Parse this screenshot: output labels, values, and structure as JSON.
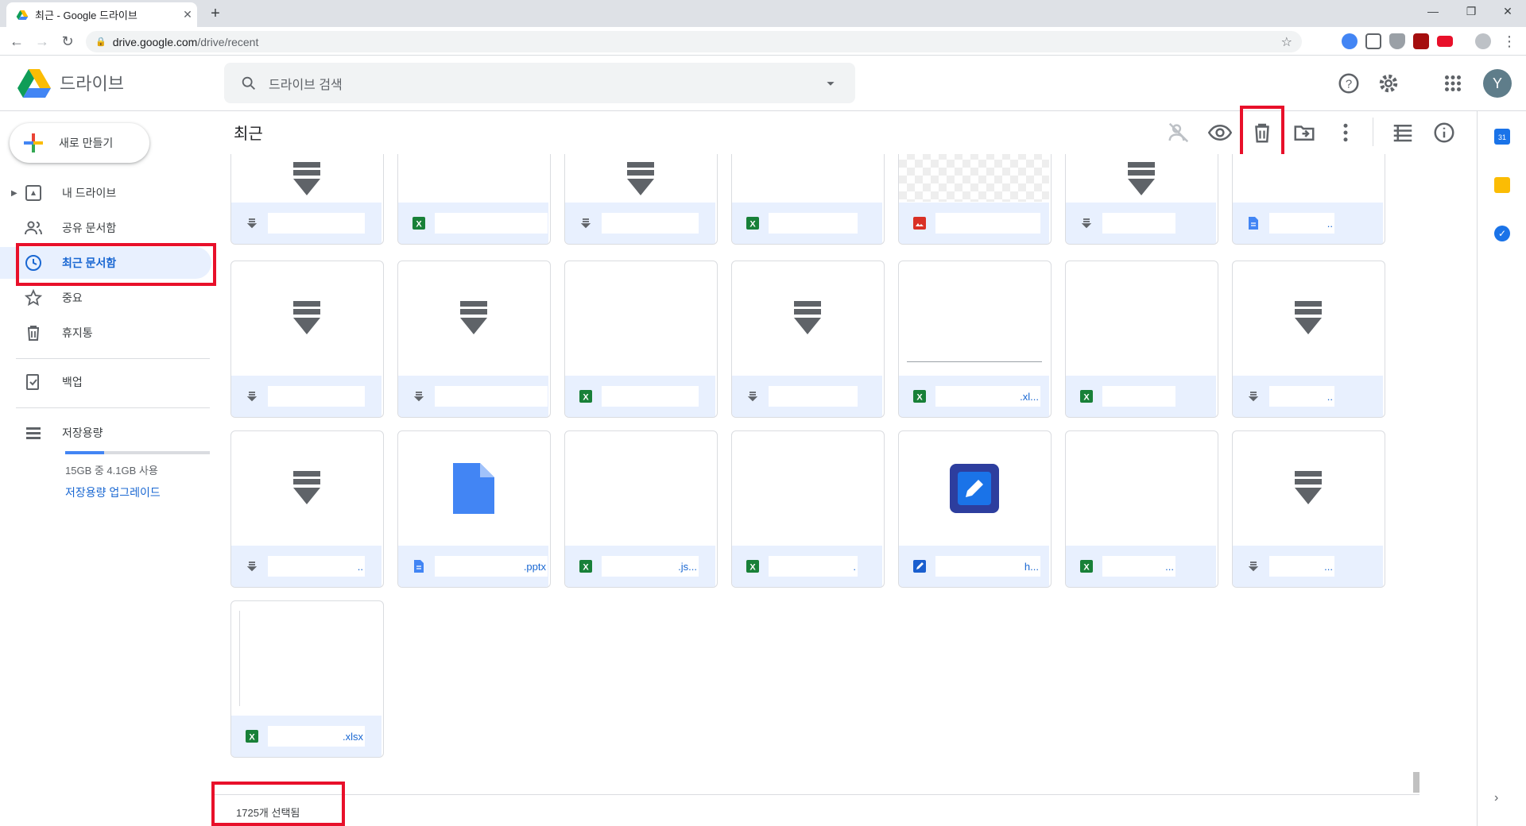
{
  "browser": {
    "tab_title": "최근 - Google 드라이브",
    "new_tab": "+",
    "tab_close": "✕",
    "url_host": "drive.google.com",
    "url_path": "/drive/recent",
    "window_controls": [
      "—",
      "❐",
      "✕"
    ]
  },
  "header": {
    "brand": "드라이브",
    "search_placeholder": "드라이브 검색",
    "avatar_letter": "Y"
  },
  "sidebar": {
    "new_label": "새로 만들기",
    "items": [
      {
        "label": "내 드라이브",
        "icon": "drive-icon"
      },
      {
        "label": "공유 문서함",
        "icon": "people-icon"
      },
      {
        "label": "최근 문서함",
        "icon": "clock-icon"
      },
      {
        "label": "중요",
        "icon": "star-icon"
      },
      {
        "label": "휴지통",
        "icon": "trash-icon"
      }
    ],
    "backup_label": "백업",
    "storage_label": "저장용량",
    "storage_used": 0.27,
    "storage_text": "15GB 중 4.1GB 사용",
    "storage_upgrade": "저장용량 업그레이드"
  },
  "content": {
    "title": "최근",
    "toolbar_icons": [
      "remove-share-icon",
      "preview-icon",
      "trash-icon",
      "move-icon",
      "more-icon",
      "list-view-icon",
      "info-icon"
    ],
    "status": "1725개 선택됨"
  },
  "files": [
    {
      "type": "generic",
      "thumb": "arrow-partial",
      "name": ""
    },
    {
      "type": "sheet",
      "thumb": "blank",
      "name": ""
    },
    {
      "type": "generic",
      "thumb": "arrow-partial",
      "name": ""
    },
    {
      "type": "sheet",
      "thumb": "blank",
      "name": ""
    },
    {
      "type": "image",
      "thumb": "checker",
      "name": ""
    },
    {
      "type": "generic",
      "thumb": "arrow-partial",
      "name": ""
    },
    {
      "type": "doc",
      "thumb": "blank",
      "name": ".."
    },
    {
      "type": "generic",
      "thumb": "arrow",
      "name": ""
    },
    {
      "type": "generic",
      "thumb": "arrow",
      "name": ""
    },
    {
      "type": "sheet",
      "thumb": "blank",
      "name": ""
    },
    {
      "type": "generic",
      "thumb": "arrow",
      "name": ""
    },
    {
      "type": "sheet",
      "thumb": "line",
      "name": ".xl..."
    },
    {
      "type": "sheet",
      "thumb": "blank",
      "name": ""
    },
    {
      "type": "generic",
      "thumb": "arrow",
      "name": ".."
    },
    {
      "type": "generic",
      "thumb": "arrow",
      "name": ".."
    },
    {
      "type": "doc",
      "thumb": "doc",
      "name": ".pptx"
    },
    {
      "type": "sheet",
      "thumb": "blank",
      "name": ".js..."
    },
    {
      "type": "sheet",
      "thumb": "blank",
      "name": "."
    },
    {
      "type": "drawio",
      "thumb": "drawio",
      "name": "h..."
    },
    {
      "type": "sheet",
      "thumb": "blank",
      "name": "..."
    },
    {
      "type": "generic",
      "thumb": "arrow",
      "name": "..."
    },
    {
      "type": "sheet",
      "thumb": "blank-left",
      "name": ".xlsx"
    }
  ],
  "colors": {
    "accent": "#1967d2",
    "highlight": "#e8102a",
    "sheet": "#188038",
    "doc": "#4285f4",
    "image": "#d93025",
    "generic": "#5f6368"
  }
}
